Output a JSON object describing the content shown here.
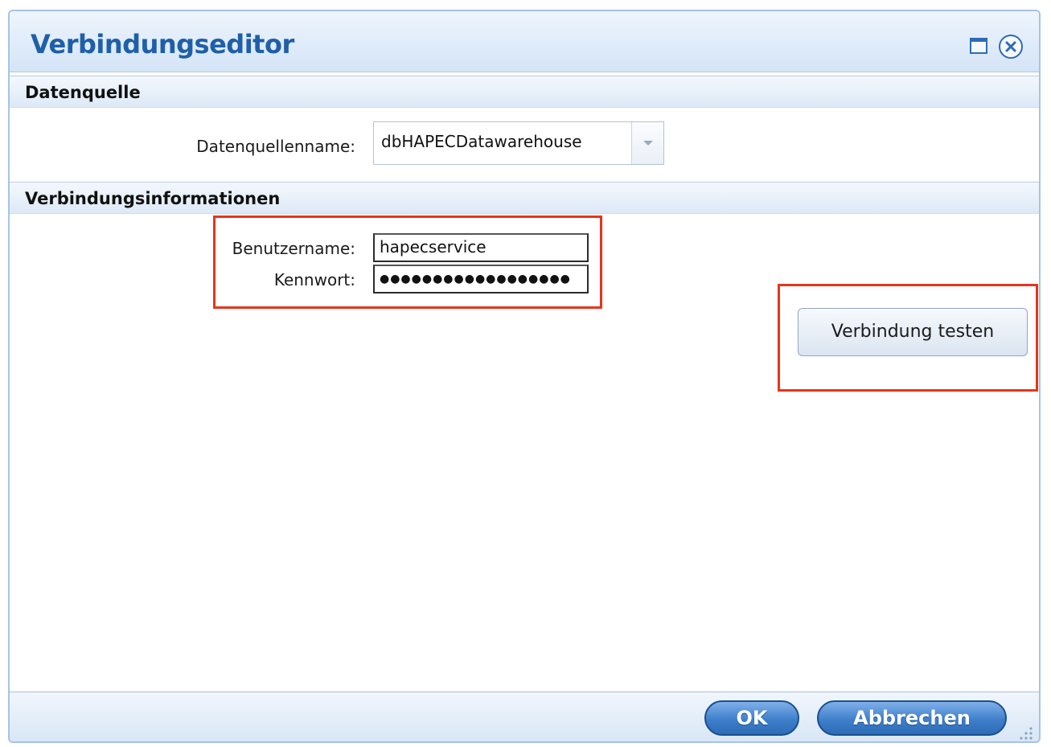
{
  "dialog": {
    "title": "Verbindungseditor"
  },
  "datasource_section": {
    "title": "Datenquelle",
    "name_label": "Datenquellenname:",
    "name_value": "dbHAPECDatawarehouse"
  },
  "connection_section": {
    "title": "Verbindungsinformationen",
    "username_label": "Benutzername:",
    "username_value": "hapecservice",
    "password_label": "Kennwort:",
    "password_masked": "●●●●●●●●●●●●●●●●●●"
  },
  "actions": {
    "test_label": "Verbindung testen",
    "ok_label": "OK",
    "cancel_label": "Abbrechen"
  },
  "colors": {
    "title": "#1f5fa8",
    "highlight": "#e8341c",
    "primary_button": "#3f7fcb"
  },
  "icons": {
    "maximize": "maximize-icon",
    "close": "close-icon",
    "dropdown": "chevron-down-icon",
    "resize": "resize-grip-icon"
  }
}
